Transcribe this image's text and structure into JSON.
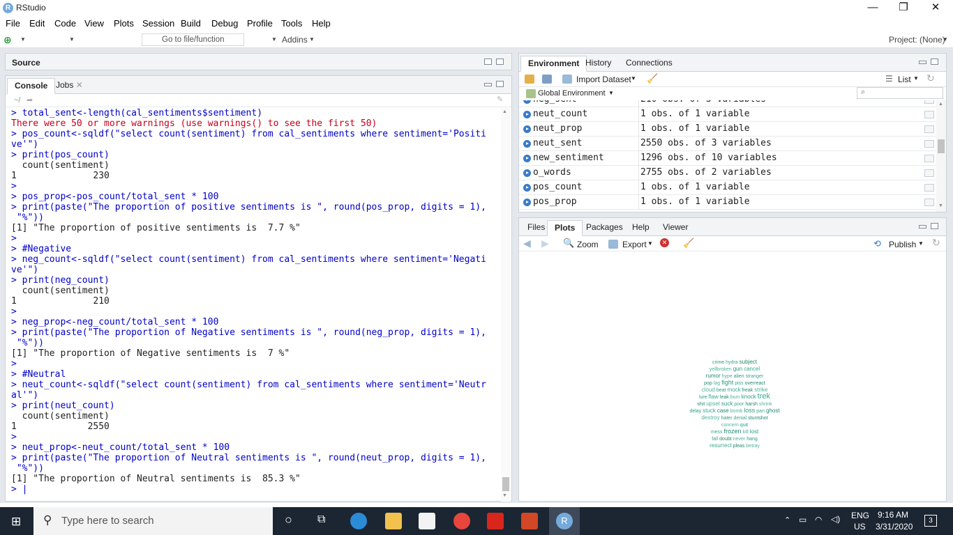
{
  "app": {
    "title": "RStudio"
  },
  "menu": [
    "File",
    "Edit",
    "Code",
    "View",
    "Plots",
    "Session",
    "Build",
    "Debug",
    "Profile",
    "Tools",
    "Help"
  ],
  "toolbar": {
    "goto_placeholder": "Go to file/function",
    "addins": "Addins",
    "project": "Project: (None)"
  },
  "source_pane": {
    "label": "Source"
  },
  "console_pane": {
    "tabs": [
      "Console",
      "Jobs"
    ],
    "path": "~/",
    "lines": [
      {
        "t": "cmd",
        "text": "> total_sent<-length(cal_sentiments$sentiment)"
      },
      {
        "t": "err",
        "text": "There were 50 or more warnings (use warnings() to see the first 50)"
      },
      {
        "t": "cmd",
        "text": "> pos_count<-sqldf(\"select count(sentiment) from cal_sentiments where sentiment='Positi"
      },
      {
        "t": "cmd",
        "text": "ve'\")"
      },
      {
        "t": "cmd",
        "text": "> print(pos_count)"
      },
      {
        "t": "out",
        "text": "  count(sentiment)"
      },
      {
        "t": "out",
        "text": "1              230"
      },
      {
        "t": "cmd",
        "text": ">"
      },
      {
        "t": "cmd",
        "text": "> pos_prop<-pos_count/total_sent * 100"
      },
      {
        "t": "cmd",
        "text": "> print(paste(\"The proportion of positive sentiments is \", round(pos_prop, digits = 1),"
      },
      {
        "t": "cmd",
        "text": " \"%\"))"
      },
      {
        "t": "out",
        "text": "[1] \"The proportion of positive sentiments is  7.7 %\""
      },
      {
        "t": "cmd",
        "text": ">"
      },
      {
        "t": "cmd",
        "text": "> #Negative"
      },
      {
        "t": "cmd",
        "text": "> neg_count<-sqldf(\"select count(sentiment) from cal_sentiments where sentiment='Negati"
      },
      {
        "t": "cmd",
        "text": "ve'\")"
      },
      {
        "t": "cmd",
        "text": "> print(neg_count)"
      },
      {
        "t": "out",
        "text": "  count(sentiment)"
      },
      {
        "t": "out",
        "text": "1              210"
      },
      {
        "t": "cmd",
        "text": ">"
      },
      {
        "t": "cmd",
        "text": "> neg_prop<-neg_count/total_sent * 100"
      },
      {
        "t": "cmd",
        "text": "> print(paste(\"The proportion of Negative sentiments is \", round(neg_prop, digits = 1),"
      },
      {
        "t": "cmd",
        "text": " \"%\"))"
      },
      {
        "t": "out",
        "text": "[1] \"The proportion of Negative sentiments is  7 %\""
      },
      {
        "t": "cmd",
        "text": ">"
      },
      {
        "t": "cmd",
        "text": "> #Neutral"
      },
      {
        "t": "cmd",
        "text": "> neut_count<-sqldf(\"select count(sentiment) from cal_sentiments where sentiment='Neutr"
      },
      {
        "t": "cmd",
        "text": "al'\")"
      },
      {
        "t": "cmd",
        "text": "> print(neut_count)"
      },
      {
        "t": "out",
        "text": "  count(sentiment)"
      },
      {
        "t": "out",
        "text": "1             2550"
      },
      {
        "t": "cmd",
        "text": ">"
      },
      {
        "t": "cmd",
        "text": "> neut_prop<-neut_count/total_sent * 100"
      },
      {
        "t": "cmd",
        "text": "> print(paste(\"The proportion of Neutral sentiments is \", round(neut_prop, digits = 1),"
      },
      {
        "t": "cmd",
        "text": " \"%\"))"
      },
      {
        "t": "out",
        "text": "[1] \"The proportion of Neutral sentiments is  85.3 %\""
      },
      {
        "t": "cmd",
        "text": "> |"
      }
    ]
  },
  "env_pane": {
    "tabs": [
      "Environment",
      "History",
      "Connections"
    ],
    "import_dataset": "Import Dataset",
    "list_view": "List",
    "scope": "Global Environment",
    "rows": [
      {
        "name": "neg_sent",
        "value": "210 obs. of 3 variables"
      },
      {
        "name": "neut_count",
        "value": "1 obs. of 1 variable"
      },
      {
        "name": "neut_prop",
        "value": "1 obs. of 1 variable"
      },
      {
        "name": "neut_sent",
        "value": "2550 obs. of 3 variables"
      },
      {
        "name": "new_sentiment",
        "value": "1296 obs. of 10 variables"
      },
      {
        "name": "o_words",
        "value": "2755 obs. of 2 variables"
      },
      {
        "name": "pos_count",
        "value": "1 obs. of 1 variable"
      },
      {
        "name": "pos_prop",
        "value": "1 obs. of 1 variable"
      }
    ]
  },
  "files_pane": {
    "tabs": [
      "Files",
      "Plots",
      "Packages",
      "Help",
      "Viewer"
    ],
    "zoom": "Zoom",
    "export": "Export",
    "publish": "Publish",
    "wordcloud": [
      {
        "w": "crime",
        "s": 7
      },
      {
        "w": "hydra",
        "s": 7
      },
      {
        "w": "subject",
        "s": 8
      },
      {
        "w": "yellbroken",
        "s": 7
      },
      {
        "w": "gun",
        "s": 8
      },
      {
        "w": "cancel",
        "s": 8
      },
      {
        "w": "rumor",
        "s": 8
      },
      {
        "w": "hype",
        "s": 7
      },
      {
        "w": "alien",
        "s": 7
      },
      {
        "w": "stranger",
        "s": 7
      },
      {
        "w": "pop",
        "s": 7
      },
      {
        "w": "lag",
        "s": 7
      },
      {
        "w": "fight",
        "s": 9
      },
      {
        "w": "piss",
        "s": 7
      },
      {
        "w": "overreact",
        "s": 7
      },
      {
        "w": "cloud",
        "s": 8
      },
      {
        "w": "beat",
        "s": 7
      },
      {
        "w": "mock",
        "s": 8
      },
      {
        "w": "freak",
        "s": 7
      },
      {
        "w": "strike",
        "s": 8
      },
      {
        "w": "lure",
        "s": 7
      },
      {
        "w": "flaw",
        "s": 8
      },
      {
        "w": "leak",
        "s": 7
      },
      {
        "w": "burn",
        "s": 7
      },
      {
        "w": "knock",
        "s": 8
      },
      {
        "w": "trek",
        "s": 11
      },
      {
        "w": "shit",
        "s": 7
      },
      {
        "w": "upset",
        "s": 8
      },
      {
        "w": "suck",
        "s": 8
      },
      {
        "w": "poor",
        "s": 7
      },
      {
        "w": "harsh",
        "s": 7
      },
      {
        "w": "shrink",
        "s": 7
      },
      {
        "w": "delay",
        "s": 7
      },
      {
        "w": "stuck",
        "s": 8
      },
      {
        "w": "case",
        "s": 8
      },
      {
        "w": "bomb",
        "s": 7
      },
      {
        "w": "loss",
        "s": 9
      },
      {
        "w": "pan",
        "s": 7
      },
      {
        "w": "ghost",
        "s": 8
      },
      {
        "w": "destroy",
        "s": 8
      },
      {
        "w": "hater",
        "s": 7
      },
      {
        "w": "denial",
        "s": 7
      },
      {
        "w": "stuntshot",
        "s": 7
      },
      {
        "w": "concern",
        "s": 7
      },
      {
        "w": "quit",
        "s": 7
      },
      {
        "w": "mess",
        "s": 7
      },
      {
        "w": "frozen",
        "s": 9
      },
      {
        "w": "kill",
        "s": 7
      },
      {
        "w": "lost",
        "s": 8
      },
      {
        "w": "fall",
        "s": 7
      },
      {
        "w": "doubt",
        "s": 7
      },
      {
        "w": "never",
        "s": 7
      },
      {
        "w": "hang",
        "s": 7
      },
      {
        "w": "resurrect",
        "s": 8
      },
      {
        "w": "pleas",
        "s": 7
      },
      {
        "w": "betray",
        "s": 7
      }
    ]
  },
  "taskbar": {
    "search_placeholder": "Type here to search",
    "lang1": "ENG",
    "lang2": "US",
    "time": "9:16 AM",
    "date": "3/31/2020",
    "notifications": "3"
  },
  "colors": {
    "accent": "#3a7bc8",
    "wordcloud": "#2a9d80",
    "taskbar": "#1c2532"
  }
}
